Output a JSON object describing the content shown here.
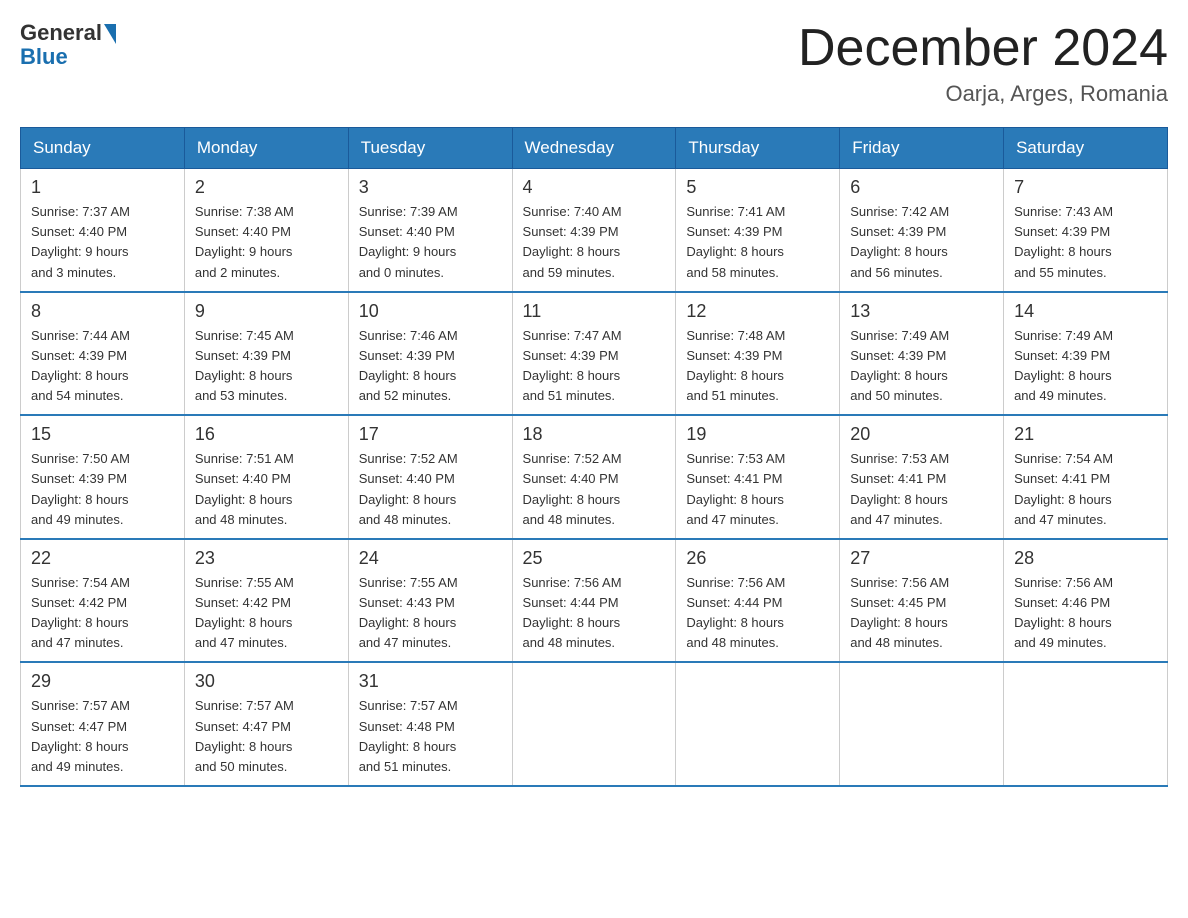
{
  "header": {
    "logo_general": "General",
    "logo_blue": "Blue",
    "title": "December 2024",
    "location": "Oarja, Arges, Romania"
  },
  "days_of_week": [
    "Sunday",
    "Monday",
    "Tuesday",
    "Wednesday",
    "Thursday",
    "Friday",
    "Saturday"
  ],
  "weeks": [
    [
      {
        "day": "1",
        "sunrise": "7:37 AM",
        "sunset": "4:40 PM",
        "daylight": "9 hours and 3 minutes."
      },
      {
        "day": "2",
        "sunrise": "7:38 AM",
        "sunset": "4:40 PM",
        "daylight": "9 hours and 2 minutes."
      },
      {
        "day": "3",
        "sunrise": "7:39 AM",
        "sunset": "4:40 PM",
        "daylight": "9 hours and 0 minutes."
      },
      {
        "day": "4",
        "sunrise": "7:40 AM",
        "sunset": "4:39 PM",
        "daylight": "8 hours and 59 minutes."
      },
      {
        "day": "5",
        "sunrise": "7:41 AM",
        "sunset": "4:39 PM",
        "daylight": "8 hours and 58 minutes."
      },
      {
        "day": "6",
        "sunrise": "7:42 AM",
        "sunset": "4:39 PM",
        "daylight": "8 hours and 56 minutes."
      },
      {
        "day": "7",
        "sunrise": "7:43 AM",
        "sunset": "4:39 PM",
        "daylight": "8 hours and 55 minutes."
      }
    ],
    [
      {
        "day": "8",
        "sunrise": "7:44 AM",
        "sunset": "4:39 PM",
        "daylight": "8 hours and 54 minutes."
      },
      {
        "day": "9",
        "sunrise": "7:45 AM",
        "sunset": "4:39 PM",
        "daylight": "8 hours and 53 minutes."
      },
      {
        "day": "10",
        "sunrise": "7:46 AM",
        "sunset": "4:39 PM",
        "daylight": "8 hours and 52 minutes."
      },
      {
        "day": "11",
        "sunrise": "7:47 AM",
        "sunset": "4:39 PM",
        "daylight": "8 hours and 51 minutes."
      },
      {
        "day": "12",
        "sunrise": "7:48 AM",
        "sunset": "4:39 PM",
        "daylight": "8 hours and 51 minutes."
      },
      {
        "day": "13",
        "sunrise": "7:49 AM",
        "sunset": "4:39 PM",
        "daylight": "8 hours and 50 minutes."
      },
      {
        "day": "14",
        "sunrise": "7:49 AM",
        "sunset": "4:39 PM",
        "daylight": "8 hours and 49 minutes."
      }
    ],
    [
      {
        "day": "15",
        "sunrise": "7:50 AM",
        "sunset": "4:39 PM",
        "daylight": "8 hours and 49 minutes."
      },
      {
        "day": "16",
        "sunrise": "7:51 AM",
        "sunset": "4:40 PM",
        "daylight": "8 hours and 48 minutes."
      },
      {
        "day": "17",
        "sunrise": "7:52 AM",
        "sunset": "4:40 PM",
        "daylight": "8 hours and 48 minutes."
      },
      {
        "day": "18",
        "sunrise": "7:52 AM",
        "sunset": "4:40 PM",
        "daylight": "8 hours and 48 minutes."
      },
      {
        "day": "19",
        "sunrise": "7:53 AM",
        "sunset": "4:41 PM",
        "daylight": "8 hours and 47 minutes."
      },
      {
        "day": "20",
        "sunrise": "7:53 AM",
        "sunset": "4:41 PM",
        "daylight": "8 hours and 47 minutes."
      },
      {
        "day": "21",
        "sunrise": "7:54 AM",
        "sunset": "4:41 PM",
        "daylight": "8 hours and 47 minutes."
      }
    ],
    [
      {
        "day": "22",
        "sunrise": "7:54 AM",
        "sunset": "4:42 PM",
        "daylight": "8 hours and 47 minutes."
      },
      {
        "day": "23",
        "sunrise": "7:55 AM",
        "sunset": "4:42 PM",
        "daylight": "8 hours and 47 minutes."
      },
      {
        "day": "24",
        "sunrise": "7:55 AM",
        "sunset": "4:43 PM",
        "daylight": "8 hours and 47 minutes."
      },
      {
        "day": "25",
        "sunrise": "7:56 AM",
        "sunset": "4:44 PM",
        "daylight": "8 hours and 48 minutes."
      },
      {
        "day": "26",
        "sunrise": "7:56 AM",
        "sunset": "4:44 PM",
        "daylight": "8 hours and 48 minutes."
      },
      {
        "day": "27",
        "sunrise": "7:56 AM",
        "sunset": "4:45 PM",
        "daylight": "8 hours and 48 minutes."
      },
      {
        "day": "28",
        "sunrise": "7:56 AM",
        "sunset": "4:46 PM",
        "daylight": "8 hours and 49 minutes."
      }
    ],
    [
      {
        "day": "29",
        "sunrise": "7:57 AM",
        "sunset": "4:47 PM",
        "daylight": "8 hours and 49 minutes."
      },
      {
        "day": "30",
        "sunrise": "7:57 AM",
        "sunset": "4:47 PM",
        "daylight": "8 hours and 50 minutes."
      },
      {
        "day": "31",
        "sunrise": "7:57 AM",
        "sunset": "4:48 PM",
        "daylight": "8 hours and 51 minutes."
      },
      null,
      null,
      null,
      null
    ]
  ],
  "labels": {
    "sunrise": "Sunrise:",
    "sunset": "Sunset:",
    "daylight": "Daylight:"
  }
}
